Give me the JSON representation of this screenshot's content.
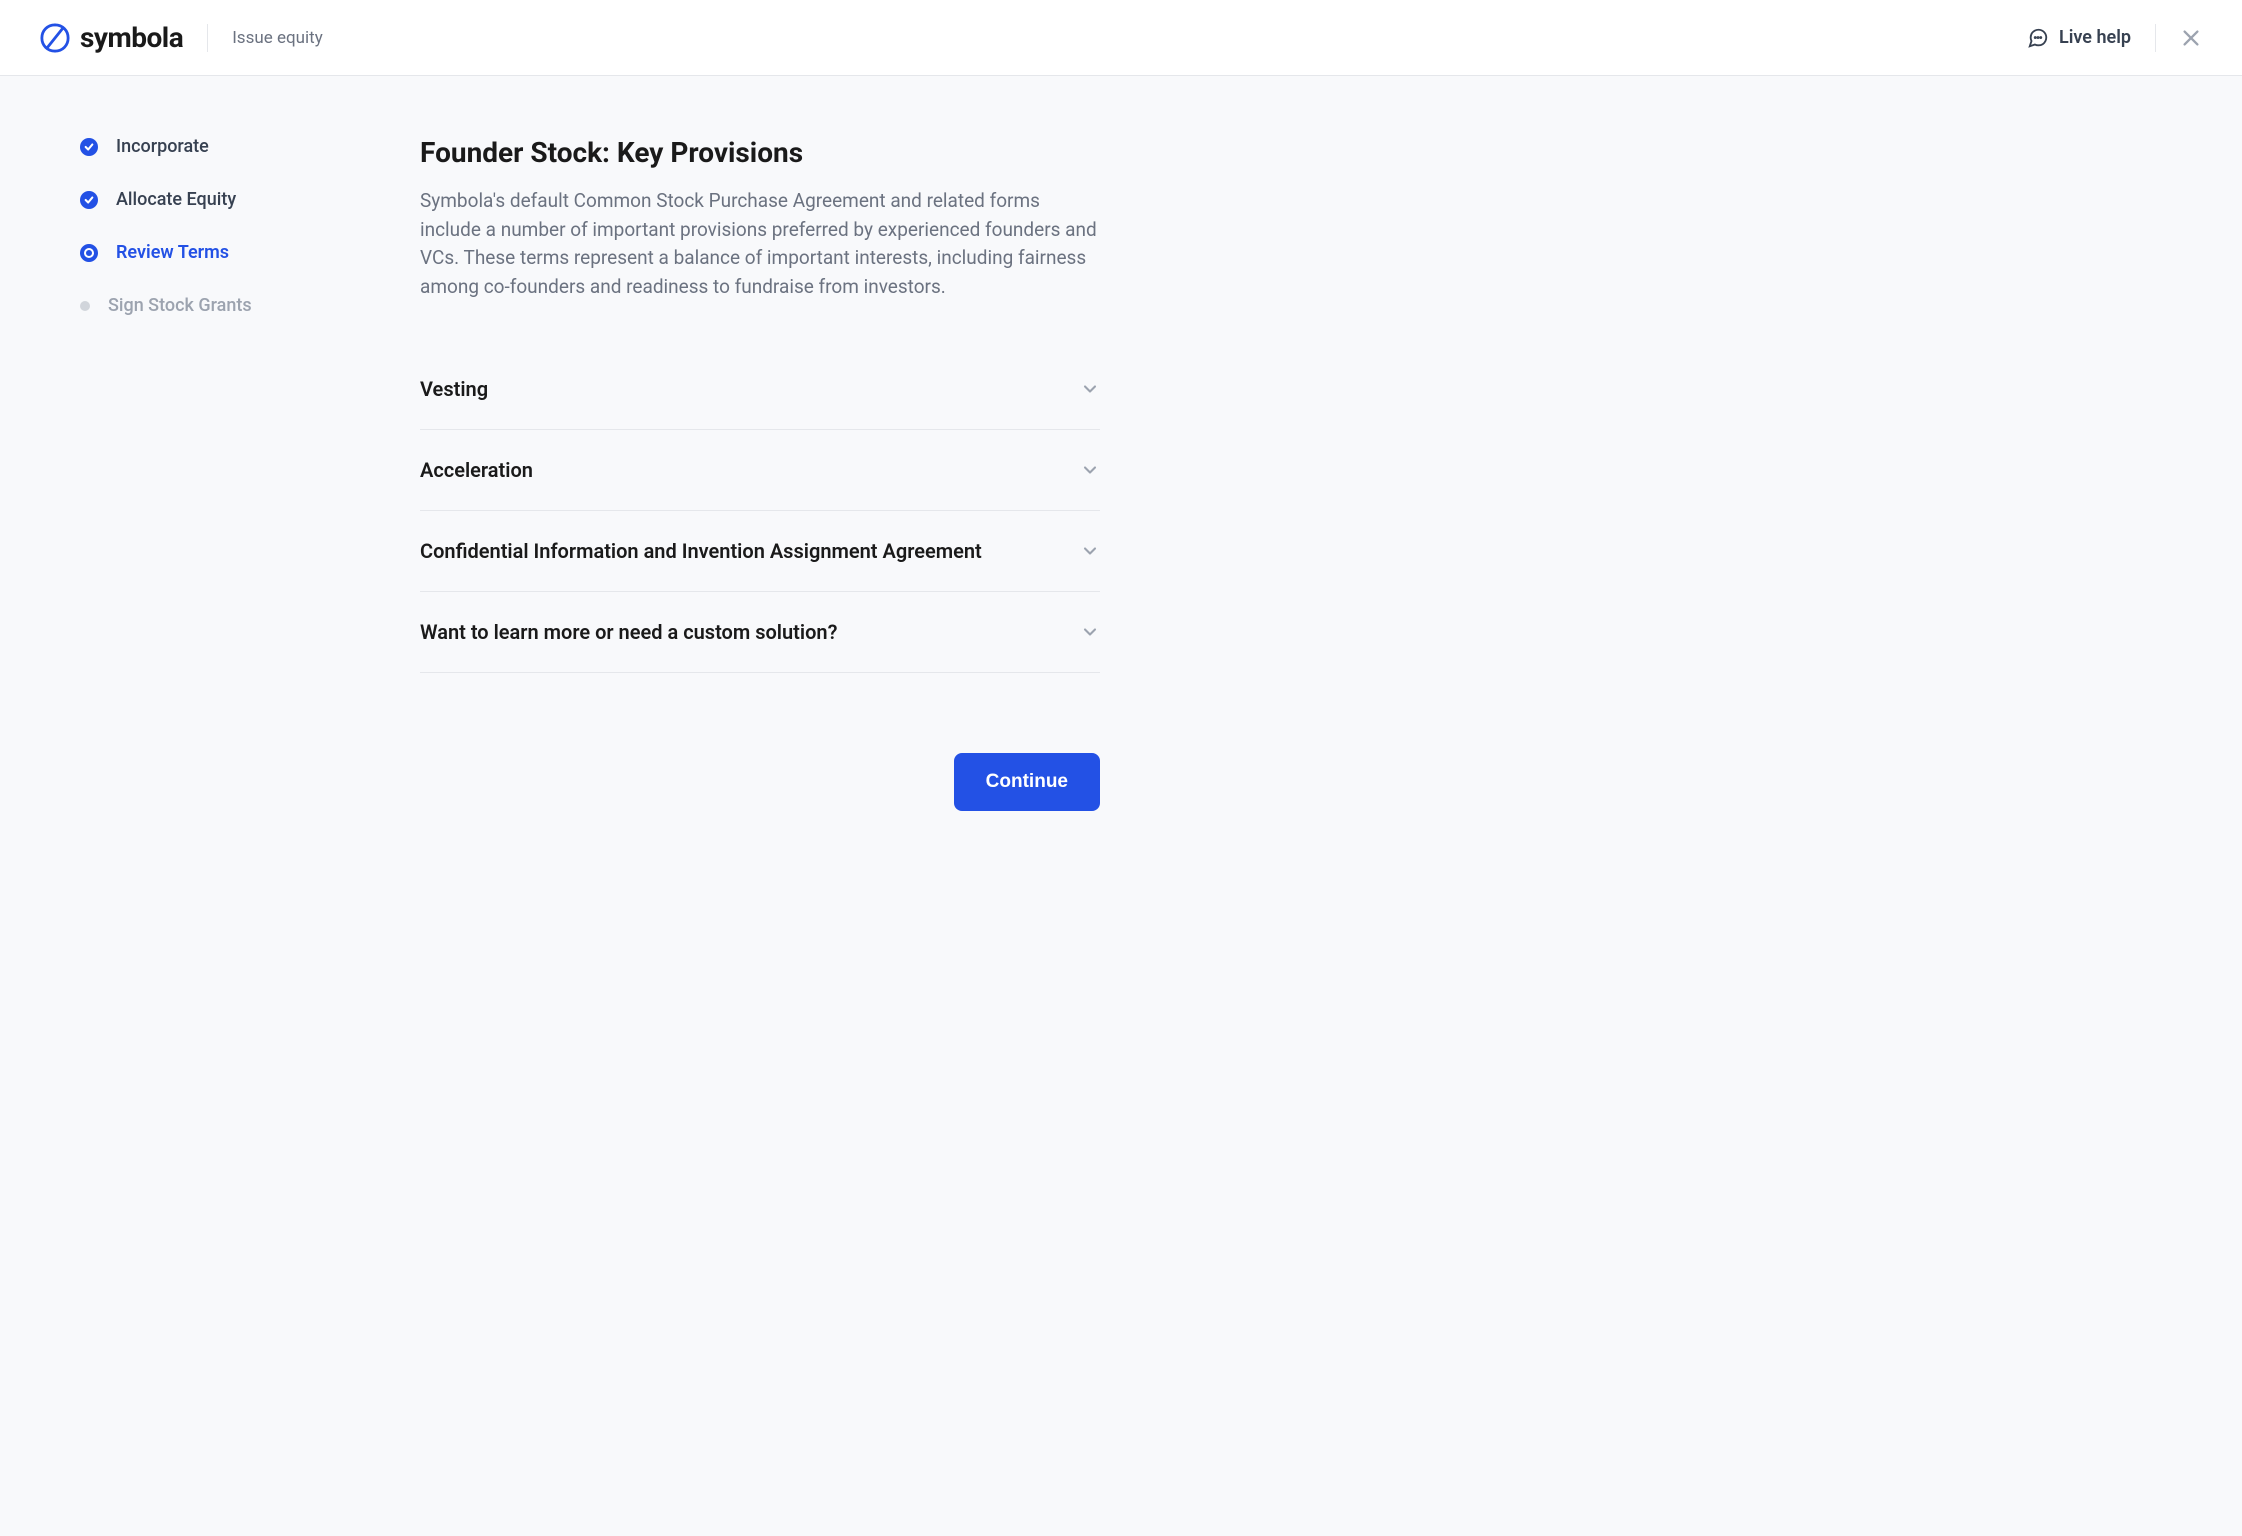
{
  "header": {
    "brand": "symbola",
    "context": "Issue equity",
    "live_help_label": "Live help"
  },
  "sidebar": {
    "steps": [
      {
        "label": "Incorporate",
        "state": "completed"
      },
      {
        "label": "Allocate Equity",
        "state": "completed"
      },
      {
        "label": "Review Terms",
        "state": "active"
      },
      {
        "label": "Sign Stock Grants",
        "state": "pending"
      }
    ]
  },
  "content": {
    "title": "Founder Stock: Key Provisions",
    "description": "Symbola's default Common Stock Purchase Agreement and related forms include a number of important provisions preferred by experienced founders and VCs.  These terms represent a balance of important interests, including fairness among co-founders and readiness to fundraise from investors.",
    "accordions": [
      {
        "title": "Vesting"
      },
      {
        "title": "Acceleration"
      },
      {
        "title": "Confidential Information and Invention Assignment Agreement"
      },
      {
        "title": "Want to learn more or need a custom solution?"
      }
    ]
  },
  "footer": {
    "continue_label": "Continue"
  },
  "colors": {
    "primary": "#2351e5",
    "muted": "#6b7280",
    "border": "#e5e7eb",
    "bg": "#f8f9fb"
  }
}
